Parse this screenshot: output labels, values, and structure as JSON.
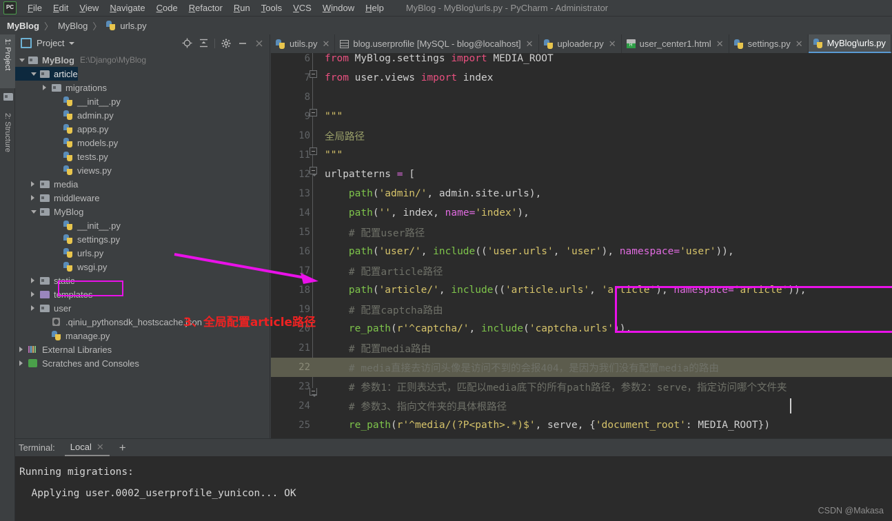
{
  "window": {
    "title": "MyBlog - MyBlog\\urls.py - PyCharm - Administrator",
    "logo": "PC"
  },
  "menu": {
    "items": [
      "File",
      "Edit",
      "View",
      "Navigate",
      "Code",
      "Refactor",
      "Run",
      "Tools",
      "VCS",
      "Window",
      "Help"
    ]
  },
  "breadcrumb": {
    "items": [
      "MyBlog",
      "MyBlog",
      "urls.py"
    ],
    "separator": "〉"
  },
  "toolstrip": {
    "project_tab": "1: Project",
    "structure_tab": "2: Structure"
  },
  "project_panel": {
    "label": "Project",
    "icons": [
      "locate-icon",
      "collapse-all-icon",
      "gear-icon",
      "minimize-icon",
      "close-icon"
    ],
    "tree": [
      {
        "depth": 0,
        "arrow": "down",
        "icon": "folder-icon",
        "label": "MyBlog",
        "path": "E:\\Django\\MyBlog",
        "bold": true,
        "selected": false
      },
      {
        "depth": 1,
        "arrow": "down",
        "icon": "folder-icon",
        "label": "article",
        "path": "",
        "bold": false,
        "selected": true
      },
      {
        "depth": 2,
        "arrow": "right",
        "icon": "folder-icon",
        "label": "migrations",
        "path": "",
        "bold": false,
        "selected": false
      },
      {
        "depth": 3,
        "arrow": "none",
        "icon": "python-file-icon",
        "label": "__init__.py",
        "path": "",
        "bold": false,
        "selected": false
      },
      {
        "depth": 3,
        "arrow": "none",
        "icon": "python-file-icon",
        "label": "admin.py",
        "path": "",
        "bold": false,
        "selected": false
      },
      {
        "depth": 3,
        "arrow": "none",
        "icon": "python-file-icon",
        "label": "apps.py",
        "path": "",
        "bold": false,
        "selected": false
      },
      {
        "depth": 3,
        "arrow": "none",
        "icon": "python-file-icon",
        "label": "models.py",
        "path": "",
        "bold": false,
        "selected": false
      },
      {
        "depth": 3,
        "arrow": "none",
        "icon": "python-file-icon",
        "label": "tests.py",
        "path": "",
        "bold": false,
        "selected": false
      },
      {
        "depth": 3,
        "arrow": "none",
        "icon": "python-file-icon",
        "label": "views.py",
        "path": "",
        "bold": false,
        "selected": false
      },
      {
        "depth": 1,
        "arrow": "right",
        "icon": "folder-icon",
        "label": "media",
        "path": "",
        "bold": false,
        "selected": false
      },
      {
        "depth": 1,
        "arrow": "right",
        "icon": "folder-icon",
        "label": "middleware",
        "path": "",
        "bold": false,
        "selected": false
      },
      {
        "depth": 1,
        "arrow": "down",
        "icon": "folder-icon",
        "label": "MyBlog",
        "path": "",
        "bold": false,
        "selected": false
      },
      {
        "depth": 3,
        "arrow": "none",
        "icon": "python-file-icon",
        "label": "__init__.py",
        "path": "",
        "bold": false,
        "selected": false
      },
      {
        "depth": 3,
        "arrow": "none",
        "icon": "python-file-icon",
        "label": "settings.py",
        "path": "",
        "bold": false,
        "selected": false
      },
      {
        "depth": 3,
        "arrow": "none",
        "icon": "python-file-icon",
        "label": "urls.py",
        "path": "",
        "bold": false,
        "selected": false
      },
      {
        "depth": 3,
        "arrow": "none",
        "icon": "python-file-icon",
        "label": "wsgi.py",
        "path": "",
        "bold": false,
        "selected": false
      },
      {
        "depth": 1,
        "arrow": "right",
        "icon": "folder-icon",
        "label": "static",
        "path": "",
        "bold": false,
        "selected": false
      },
      {
        "depth": 1,
        "arrow": "right",
        "icon": "folder-violet-icon",
        "label": "templates",
        "path": "",
        "bold": false,
        "selected": false
      },
      {
        "depth": 1,
        "arrow": "right",
        "icon": "folder-icon",
        "label": "user",
        "path": "",
        "bold": false,
        "selected": false
      },
      {
        "depth": 2,
        "arrow": "none",
        "icon": "json-file-icon",
        "label": ".qiniu_pythonsdk_hostscache.json",
        "path": "",
        "bold": false,
        "selected": false
      },
      {
        "depth": 2,
        "arrow": "none",
        "icon": "python-file-icon",
        "label": "manage.py",
        "path": "",
        "bold": false,
        "selected": false
      },
      {
        "depth": 0,
        "arrow": "right",
        "icon": "library-icon",
        "label": "External Libraries",
        "path": "",
        "bold": false,
        "selected": false
      },
      {
        "depth": 0,
        "arrow": "right",
        "icon": "scratches-icon",
        "label": "Scratches and Consoles",
        "path": "",
        "bold": false,
        "selected": false
      }
    ]
  },
  "editor": {
    "tabs": [
      {
        "label": "utils.py",
        "icon": "python-file-icon",
        "active": false,
        "closable": true
      },
      {
        "label": "blog.userprofile [MySQL - blog@localhost]",
        "icon": "table-icon",
        "active": false,
        "closable": true
      },
      {
        "label": "uploader.py",
        "icon": "python-file-icon",
        "active": false,
        "closable": true
      },
      {
        "label": "user_center1.html",
        "icon": "html-file-icon",
        "active": false,
        "closable": true
      },
      {
        "label": "settings.py",
        "icon": "python-file-icon",
        "active": false,
        "closable": true
      },
      {
        "label": "MyBlog\\urls.py",
        "icon": "python-file-icon",
        "active": true,
        "closable": false
      }
    ],
    "lines": [
      {
        "no": "6",
        "text": "from MyBlog.settings import MEDIA_ROOT"
      },
      {
        "no": "7",
        "text": "from user.views import index"
      },
      {
        "no": "8",
        "text": ""
      },
      {
        "no": "9",
        "text": "\"\"\""
      },
      {
        "no": "10",
        "text": "全局路径"
      },
      {
        "no": "11",
        "text": "\"\"\""
      },
      {
        "no": "12",
        "text": "urlpatterns = ["
      },
      {
        "no": "13",
        "text": "    path('admin/', admin.site.urls),"
      },
      {
        "no": "14",
        "text": "    path('', index, name='index'),"
      },
      {
        "no": "15",
        "text": "    # 配置user路径"
      },
      {
        "no": "16",
        "text": "    path('user/', include(('user.urls', 'user'), namespace='user')),"
      },
      {
        "no": "17",
        "text": "    # 配置article路径"
      },
      {
        "no": "18",
        "text": "    path('article/', include(('article.urls', 'article'), namespace='article')),"
      },
      {
        "no": "19",
        "text": "    # 配置captcha路由"
      },
      {
        "no": "20",
        "text": "    re_path(r'^captcha/', include('captcha.urls')),"
      },
      {
        "no": "21",
        "text": "    # 配置media路由"
      },
      {
        "no": "22",
        "text": "    # media直接去访问头像是访问不到的会报404，是因为我们没有配置media的路由"
      },
      {
        "no": "23",
        "text": "    # 参数1：正则表达式，匹配以media底下的所有path路径，参数2：serve，指定访问哪个文件夹"
      },
      {
        "no": "24",
        "text": "    # 参数3、指向文件夹的具体根路径"
      },
      {
        "no": "25",
        "text": "    re_path(r'^media/(?P<path>.*)$', serve, {'document_root': MEDIA_ROOT})"
      }
    ]
  },
  "annotations": {
    "red_note": "3、全局配置article路径",
    "highlight_color": "#e911e9",
    "note_color": "#ee2222"
  },
  "terminal": {
    "title": "Terminal:",
    "tab": "Local",
    "add_label": "+",
    "lines": [
      "Running migrations:",
      "  Applying user.0002_userprofile_yunicon... OK"
    ]
  },
  "watermark": "CSDN @Makasa"
}
